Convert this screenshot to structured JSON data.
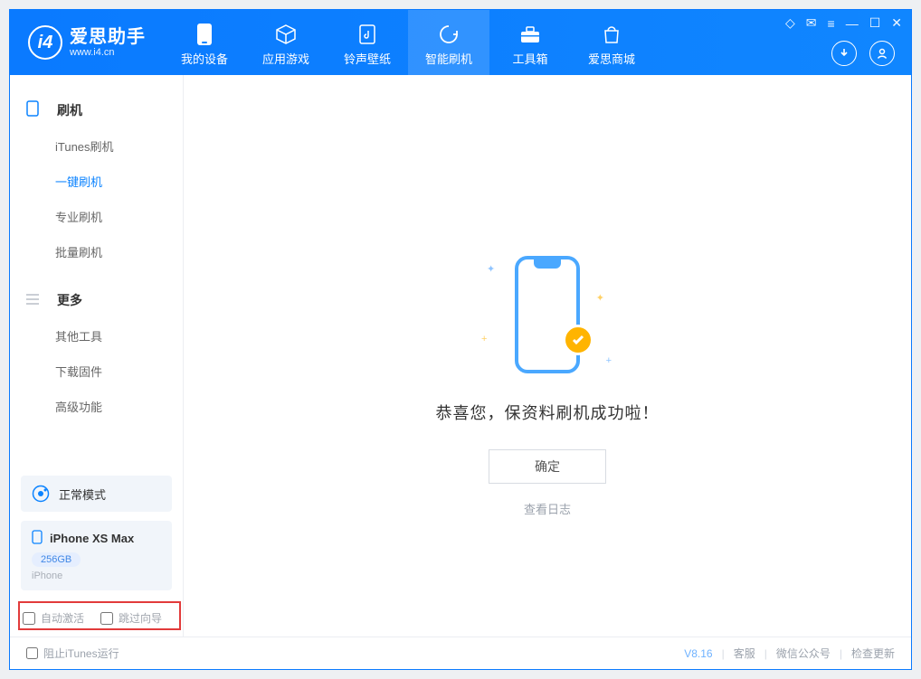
{
  "app": {
    "name": "爱思助手",
    "subtitle": "www.i4.cn"
  },
  "top_tabs": {
    "my_device": "我的设备",
    "app_games": "应用游戏",
    "ringtones": "铃声壁纸",
    "smart_flash": "智能刷机",
    "toolbox": "工具箱",
    "store": "爱思商城"
  },
  "sidebar": {
    "section_flash": "刷机",
    "items_flash": {
      "itunes": "iTunes刷机",
      "one_click": "一键刷机",
      "pro": "专业刷机",
      "batch": "批量刷机"
    },
    "section_more": "更多",
    "items_more": {
      "other_tools": "其他工具",
      "download_fw": "下载固件",
      "advanced": "高级功能"
    }
  },
  "device_status": {
    "mode": "正常模式",
    "name": "iPhone XS Max",
    "storage": "256GB",
    "type": "iPhone"
  },
  "options": {
    "auto_activate": "自动激活",
    "skip_guide": "跳过向导"
  },
  "result": {
    "message": "恭喜您，保资料刷机成功啦！",
    "ok": "确定",
    "view_log": "查看日志"
  },
  "footer": {
    "block_itunes": "阻止iTunes运行",
    "version": "V8.16",
    "cs": "客服",
    "wechat": "微信公众号",
    "update": "检查更新"
  }
}
